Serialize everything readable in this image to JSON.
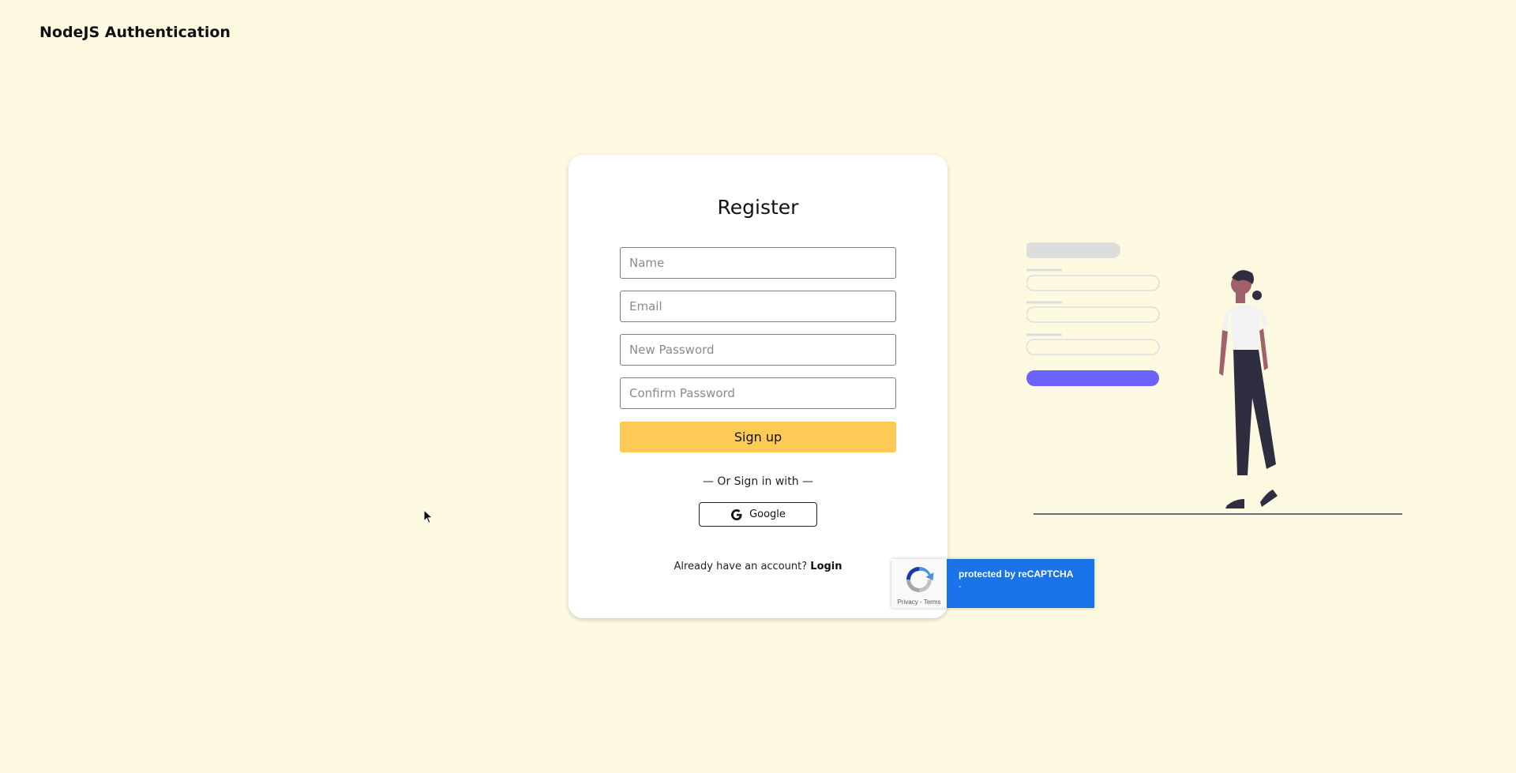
{
  "header": {
    "brand": "NodeJS Authentication"
  },
  "form": {
    "title": "Register",
    "fields": {
      "name_placeholder": "Name",
      "email_placeholder": "Email",
      "new_password_placeholder": "New Password",
      "confirm_password_placeholder": "Confirm Password"
    },
    "signup_label": "Sign up",
    "or_text": "— Or Sign in with —",
    "google_label": "Google",
    "login_prompt": "Already have an account?",
    "login_link": "Login"
  },
  "recaptcha": {
    "label": "protected by reCAPTCHA",
    "sub": "-",
    "links": "Privacy - Terms"
  },
  "colors": {
    "background": "#fef9e1",
    "accent_button": "#fdcb55",
    "illustration_button": "#6c63ff",
    "recaptcha_blue": "#1a73e8"
  },
  "icons": [
    "google-icon",
    "recaptcha-icon",
    "mouse-cursor-icon"
  ]
}
